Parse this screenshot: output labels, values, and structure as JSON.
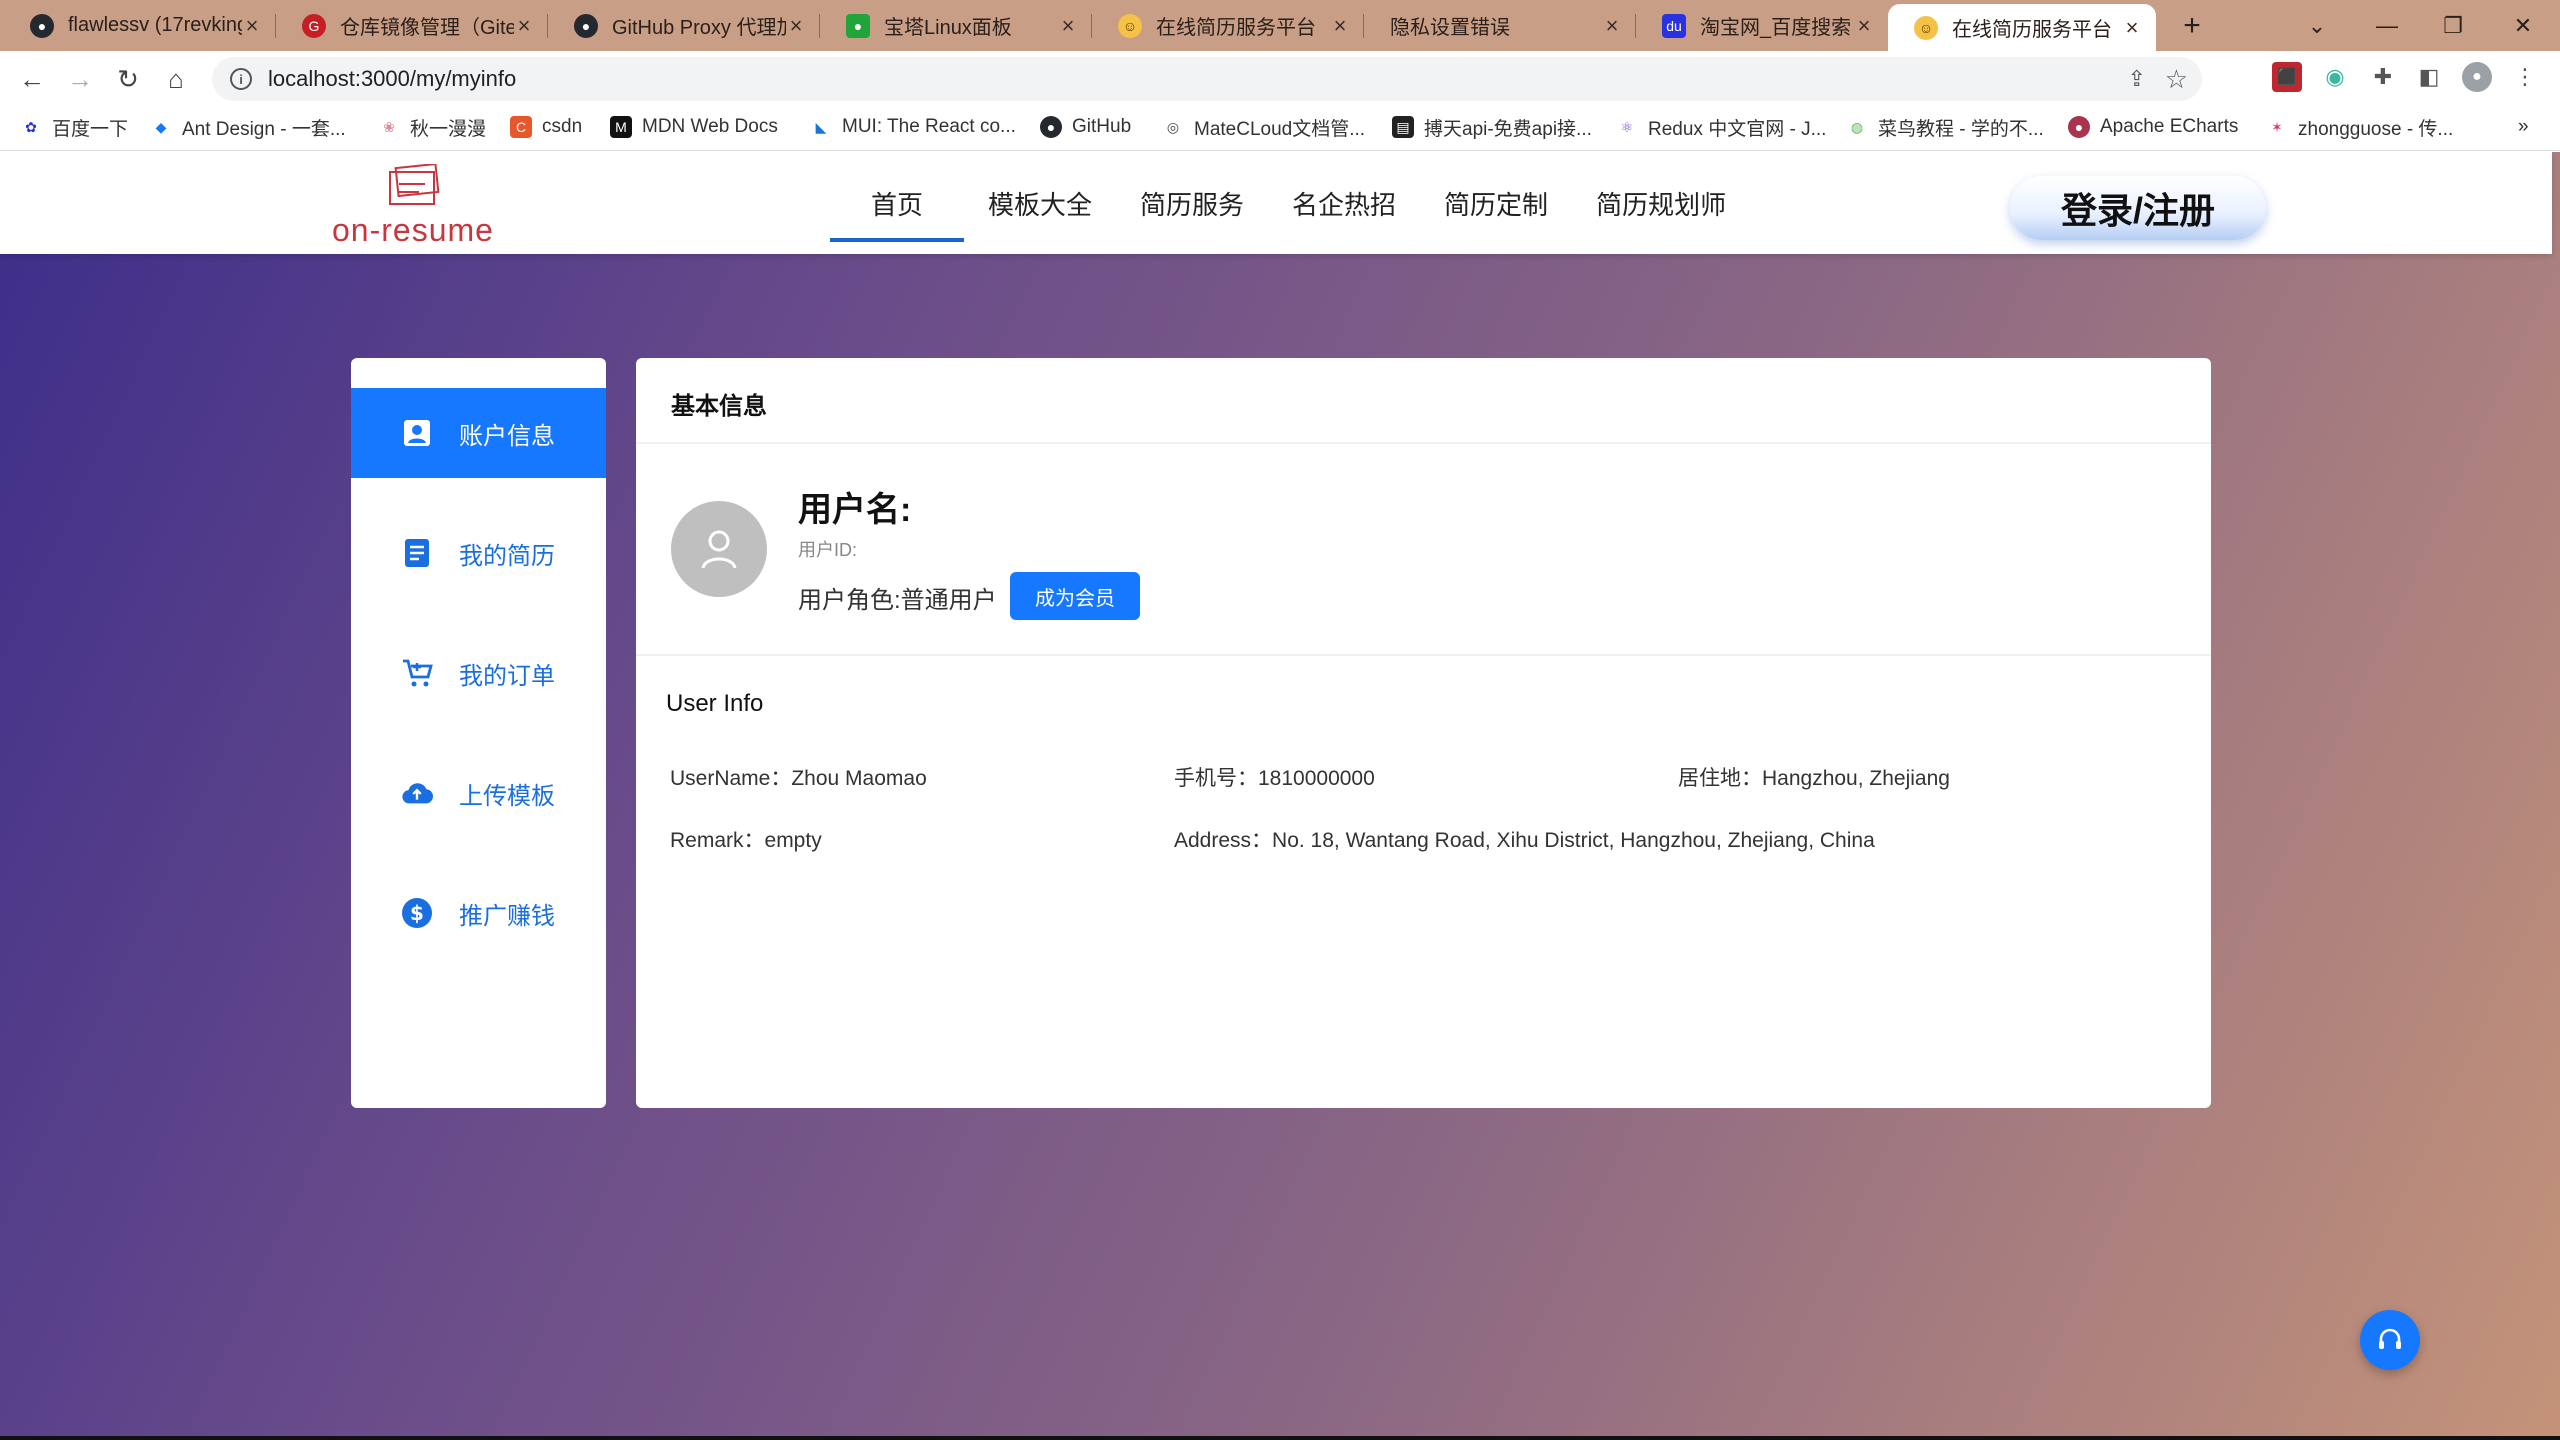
{
  "browser": {
    "tabs": [
      {
        "title": "flawlessv (17revking",
        "icon": "github-icon"
      },
      {
        "title": "仓库镜像管理（Gite",
        "icon": "gitee-icon"
      },
      {
        "title": "GitHub Proxy 代理加",
        "icon": "github-icon"
      },
      {
        "title": "宝塔Linux面板",
        "icon": "bt-panel-icon"
      },
      {
        "title": "在线简历服务平台",
        "icon": "smile-icon"
      },
      {
        "title": "隐私设置错误",
        "icon": ""
      },
      {
        "title": "淘宝网_百度搜索",
        "icon": "baidu-icon"
      },
      {
        "title": "在线简历服务平台",
        "icon": "smile-icon"
      }
    ],
    "active_tab": 7,
    "url": "localhost:3000/my/myinfo",
    "bookmarks": [
      {
        "label": "百度一下"
      },
      {
        "label": "Ant Design - 一套..."
      },
      {
        "label": "秋一漫漫"
      },
      {
        "label": "csdn"
      },
      {
        "label": "MDN Web Docs"
      },
      {
        "label": "MUI: The React co..."
      },
      {
        "label": "GitHub"
      },
      {
        "label": "MateCLoud文档管..."
      },
      {
        "label": "搏天api-免费api接..."
      },
      {
        "label": "Redux 中文官网 - J..."
      },
      {
        "label": "菜鸟教程 - 学的不..."
      },
      {
        "label": "Apache ECharts"
      },
      {
        "label": "zhongguose - 传..."
      }
    ],
    "more_bookmarks": "»"
  },
  "site": {
    "logo_text": "on-resume",
    "nav": [
      "首页",
      "模板大全",
      "简历服务",
      "名企热招",
      "简历定制",
      "简历规划师"
    ],
    "active_nav": 0,
    "login_label": "登录/注册"
  },
  "sidebar": {
    "items": [
      {
        "label": "账户信息",
        "icon": "account-card-icon"
      },
      {
        "label": "我的简历",
        "icon": "document-icon"
      },
      {
        "label": "我的订单",
        "icon": "cart-icon"
      },
      {
        "label": "上传模板",
        "icon": "cloud-upload-icon"
      },
      {
        "label": "推广赚钱",
        "icon": "dollar-icon"
      }
    ],
    "active": 0
  },
  "profile": {
    "section_title": "基本信息",
    "username_label": "用户名:",
    "user_id_label": "用户ID:",
    "role_text": "用户角色:普通用户",
    "vip_button": "成为会员"
  },
  "user_info": {
    "title": "User Info",
    "username": "UserName：Zhou Maomao",
    "phone": "手机号：1810000000",
    "residence": "居住地：Hangzhou, Zhejiang",
    "remark": "Remark：empty",
    "address": "Address：No. 18, Wantang Road, Xihu District, Hangzhou, Zhejiang, China"
  },
  "colors": {
    "primary": "#1677ff",
    "brand": "#c8363f",
    "tabstrip": "#c89f86"
  }
}
